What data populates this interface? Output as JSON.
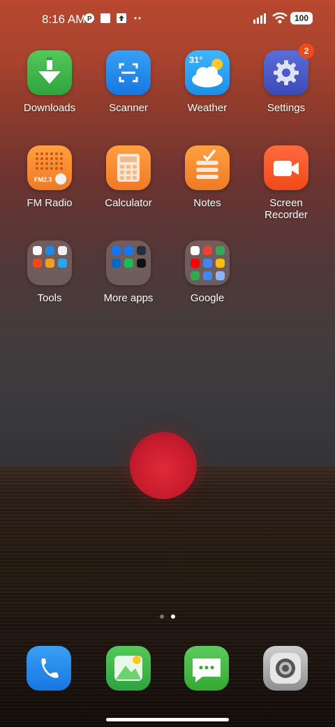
{
  "status_bar": {
    "time": "8:16 AM",
    "battery": "100",
    "icons": [
      "p-icon",
      "square-icon",
      "upload-icon",
      "more-dots-icon",
      "signal-icon",
      "wifi-icon"
    ]
  },
  "apps": [
    {
      "label": "Downloads"
    },
    {
      "label": "Scanner"
    },
    {
      "label": "Weather",
      "temp": "31°"
    },
    {
      "label": "Settings",
      "badge": "2"
    },
    {
      "label": "FM Radio",
      "freq": "FM2.3"
    },
    {
      "label": "Calculator"
    },
    {
      "label": "Notes"
    },
    {
      "label": "Screen Recorder"
    },
    {
      "label": "Tools"
    },
    {
      "label": "More apps"
    },
    {
      "label": "Google"
    }
  ],
  "dock": [
    "phone-icon",
    "gallery-icon",
    "messages-icon",
    "camera-icon"
  ],
  "colors": {
    "downloads": "#39b34a",
    "scanner": "#1e88e5",
    "weather": "#27a6f0",
    "settings": "#4a5cc7",
    "orange": "#f07a25",
    "recorder": "#f4511e",
    "phone": "#1e88e5",
    "gallery": "#3fb34a",
    "messages": "#4cbf4c",
    "camera": "#a6a6a6"
  }
}
